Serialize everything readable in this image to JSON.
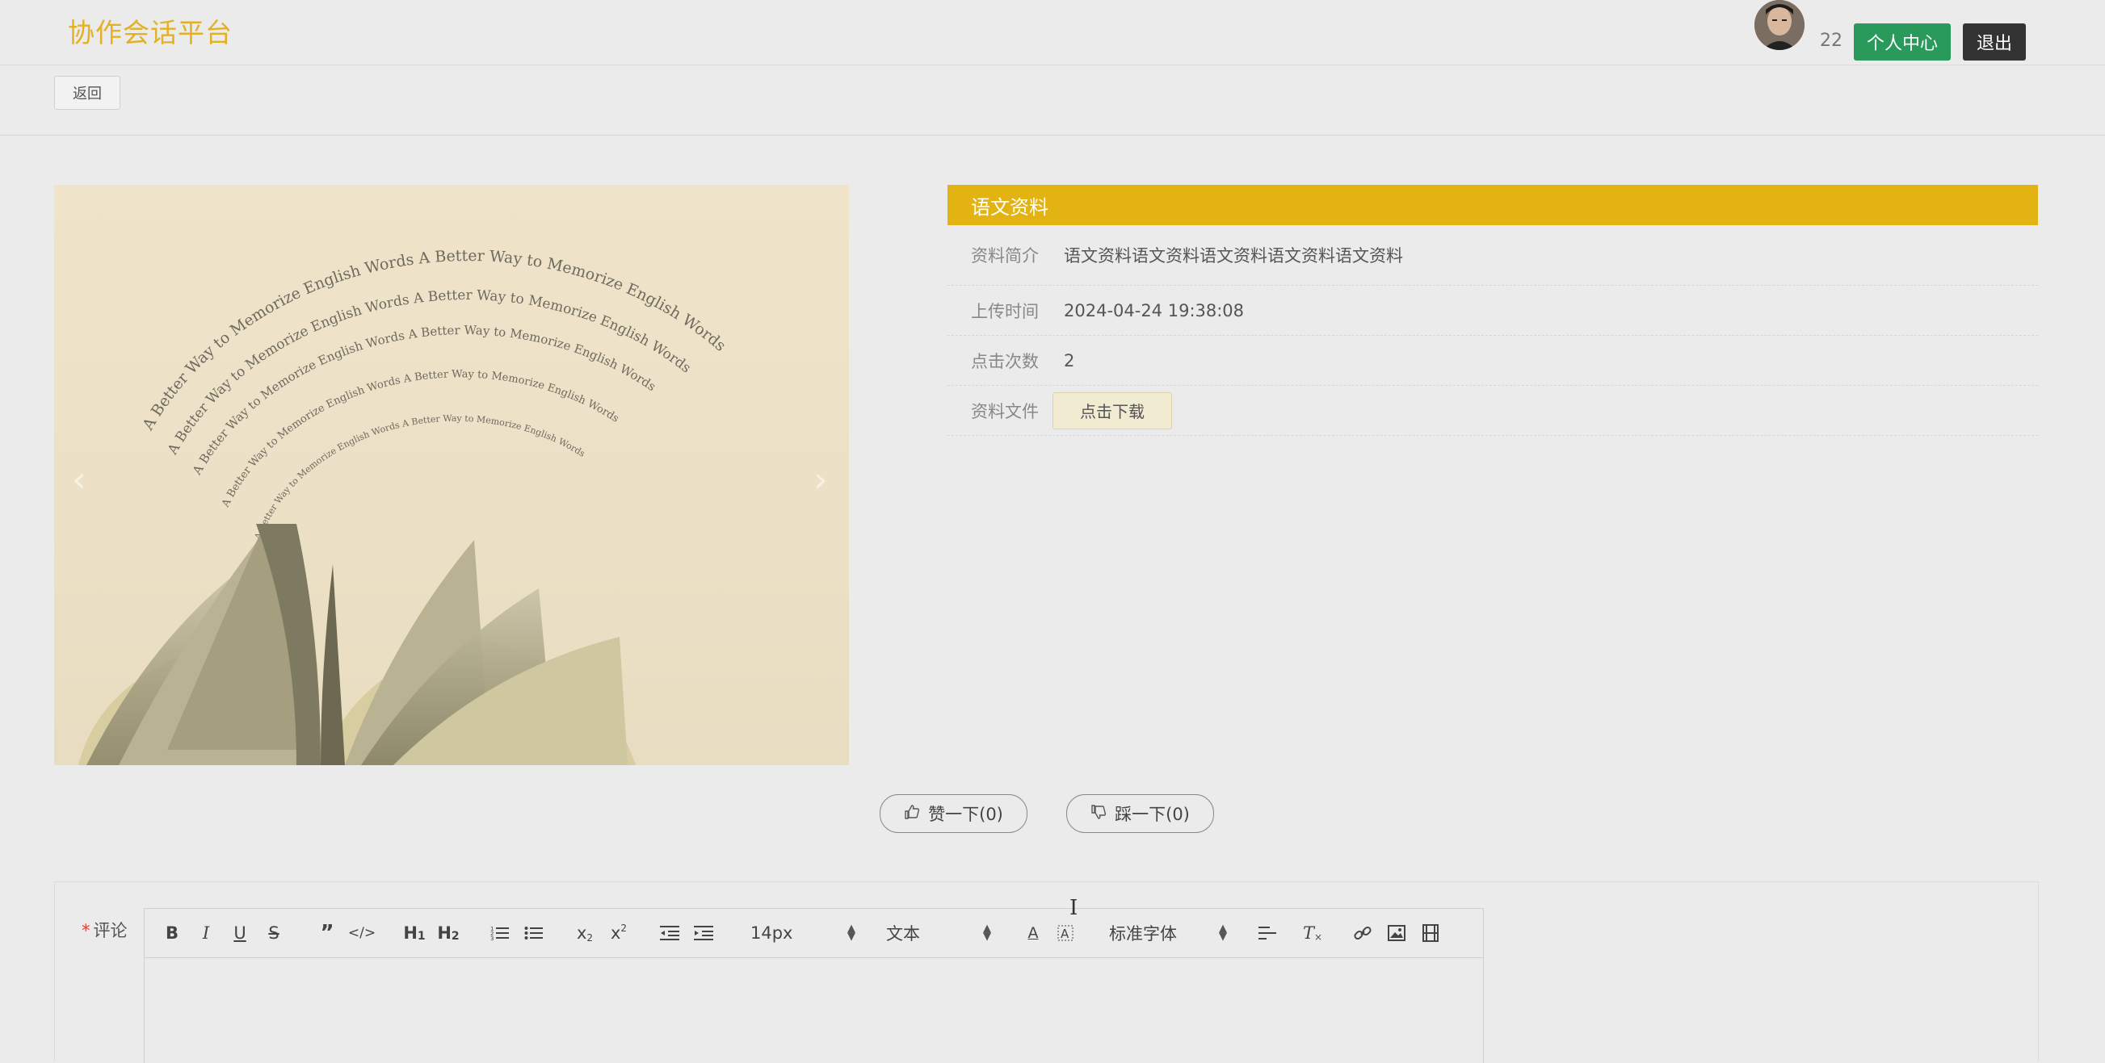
{
  "header": {
    "logo": "协作会话平台",
    "user_count": "22",
    "personal_center": "个人中心",
    "logout": "退出"
  },
  "nav": {
    "back": "返回"
  },
  "material": {
    "title": "语文资料",
    "rows": [
      {
        "label": "资料简介",
        "value": "语文资料语文资料语文资料语文资料语文资料"
      },
      {
        "label": "上传时间",
        "value": "2024-04-24 19:38:08"
      },
      {
        "label": "点击次数",
        "value": "2"
      },
      {
        "label": "资料文件",
        "button": "点击下载"
      }
    ]
  },
  "cover": {
    "lines": [
      "A Better Way to Memorize English Words A Better Way to Memorize English Words",
      "A Better Way to Memorize English Words A Better Way to Memorize English Words",
      "A Better Way to Memorize English Words A Better Way to Memorize English Words",
      "A Better Way to Memorize English Words A Better Way to Memorize English Words",
      "A Better Way to Memorize English Words A Better Way to Memorize English Words"
    ]
  },
  "votes": {
    "like": "赞一下(0)",
    "dislike": "踩一下(0)"
  },
  "comment": {
    "required_mark": "*",
    "label": "评论",
    "toolbar": {
      "font_size": "14px",
      "block_type": "文本",
      "font_family": "标准字体"
    }
  },
  "colors": {
    "brand": "#e2b125",
    "title_bar": "#e3b314",
    "green_button": "#2a9a5c",
    "dark_button": "#333333"
  }
}
